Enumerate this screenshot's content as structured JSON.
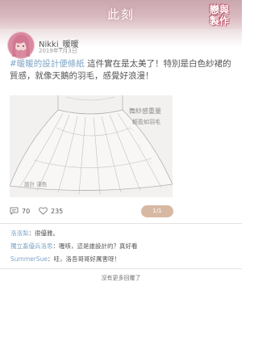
{
  "header": {
    "title": "此刻",
    "logo_text_line1": "戀與",
    "logo_text_line2": "製作"
  },
  "post": {
    "username": "Nikki_暖暖",
    "date": "2019年7月3日",
    "hashtag": "#暖暖的設計便條紙",
    "text": " 這件實在是太美了！特別是白色紗裙的質感，就像天鵝的羽毛，感覺好浪漫！",
    "sketch_note_line1": "舞紗感重量",
    "sketch_note_line2": "輕盈如羽毛",
    "sketch_note_side": "設計 淺色",
    "counter": "1/1",
    "comments_count": "70",
    "likes_count": "235"
  },
  "comments": [
    {
      "author": "洛洛梨",
      "text": "很優雅。"
    },
    {
      "author": "獨立畜優兵洛思",
      "text": "喔咳，這是誰設計的？真好看"
    },
    {
      "author": "SummerSue",
      "text": "哇，洛吾哥哥好厲害呀！"
    }
  ],
  "footer": {
    "no_more": "沒有更多回覆了"
  }
}
